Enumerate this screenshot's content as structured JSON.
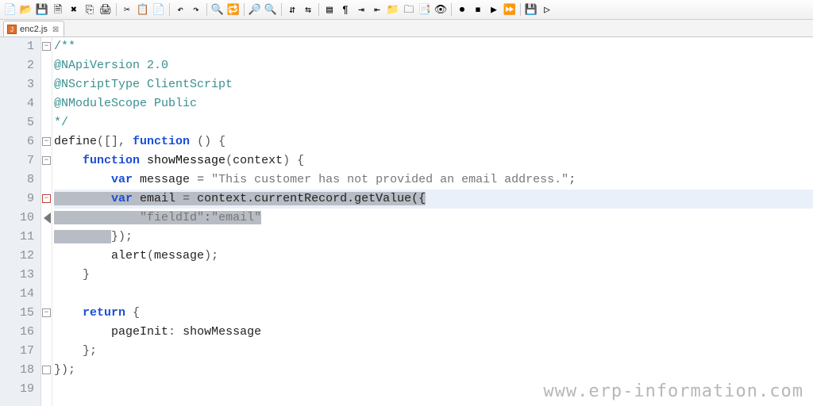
{
  "toolbar_icons": [
    {
      "name": "new-file-icon",
      "glyph": "📄"
    },
    {
      "name": "open-icon",
      "glyph": "📂"
    },
    {
      "name": "save-icon",
      "glyph": "💾"
    },
    {
      "name": "save-all-icon",
      "glyph": "🗎"
    },
    {
      "name": "close-icon",
      "glyph": "✖"
    },
    {
      "name": "close-all-icon",
      "glyph": "⎘"
    },
    {
      "name": "print-icon",
      "glyph": "🖨"
    },
    {
      "sep": true
    },
    {
      "name": "cut-icon",
      "glyph": "✂"
    },
    {
      "name": "copy-icon",
      "glyph": "📋"
    },
    {
      "name": "paste-icon",
      "glyph": "📄"
    },
    {
      "sep": true
    },
    {
      "name": "undo-icon",
      "glyph": "↶"
    },
    {
      "name": "redo-icon",
      "glyph": "↷"
    },
    {
      "sep": true
    },
    {
      "name": "find-icon",
      "glyph": "🔍"
    },
    {
      "name": "replace-icon",
      "glyph": "🔁"
    },
    {
      "sep": true
    },
    {
      "name": "zoom-in-icon",
      "glyph": "🔎"
    },
    {
      "name": "zoom-out-icon",
      "glyph": "🔍"
    },
    {
      "sep": true
    },
    {
      "name": "sync-v-icon",
      "glyph": "⇵"
    },
    {
      "name": "sync-h-icon",
      "glyph": "⇆"
    },
    {
      "sep": true
    },
    {
      "name": "wrap-icon",
      "glyph": "▤"
    },
    {
      "name": "show-all-icon",
      "glyph": "¶"
    },
    {
      "name": "indent-icon",
      "glyph": "⇥"
    },
    {
      "name": "outdent-icon",
      "glyph": "⇤"
    },
    {
      "name": "folder-icon",
      "glyph": "📁"
    },
    {
      "name": "doc-map-icon",
      "glyph": "🗀"
    },
    {
      "name": "func-list-icon",
      "glyph": "📑"
    },
    {
      "name": "monitor-icon",
      "glyph": "👁"
    },
    {
      "sep": true
    },
    {
      "name": "record-icon",
      "glyph": "⏺"
    },
    {
      "name": "stop-icon",
      "glyph": "⏹"
    },
    {
      "name": "play-icon",
      "glyph": "▶"
    },
    {
      "name": "fast-icon",
      "glyph": "⏩"
    },
    {
      "sep": true
    },
    {
      "name": "save-macro-icon",
      "glyph": "💾"
    },
    {
      "name": "run-macro-icon",
      "glyph": "▷"
    }
  ],
  "tab": {
    "filename": "enc2.js",
    "close_glyph": "⊠"
  },
  "code_lines": [
    {
      "n": 1,
      "html": "<span class='c-comment'>/**</span>"
    },
    {
      "n": 2,
      "html": "<span class='c-comment'>@NApiVersion 2.0</span>"
    },
    {
      "n": 3,
      "html": "<span class='c-comment'>@NScriptType ClientScript</span>"
    },
    {
      "n": 4,
      "html": "<span class='c-comment'>@NModuleScope Public</span>"
    },
    {
      "n": 5,
      "html": "<span class='c-comment'>*/</span>"
    },
    {
      "n": 6,
      "html": "<span class='c-plain'>define</span><span class='c-punc'>([], </span><span class='c-kw'>function</span> <span class='c-punc'>() {</span>"
    },
    {
      "n": 7,
      "html": "    <span class='c-kw'>function</span> <span class='c-fn'>showMessage</span><span class='c-punc'>(</span><span class='c-plain'>context</span><span class='c-punc'>) {</span>"
    },
    {
      "n": 8,
      "html": "        <span class='c-kw'>var</span> <span class='c-plain'>message</span> <span class='c-punc'>=</span> <span class='c-str'>\"This customer has not provided an email address.\"</span><span class='c-punc'>;</span>"
    },
    {
      "n": 9,
      "html": "<span class='sel'>        </span><span class='c-kw sel'>var</span><span class='sel'> </span><span class='c-plain sel'>email</span><span class='sel'> </span><span class='c-punc sel'>=</span><span class='sel'> </span><span class='c-plain sel'>context.currentRecord.getValue({</span>",
      "cl": "curline"
    },
    {
      "n": 10,
      "html": "<span class='sel'>            </span><span class='c-str sel'>\"fieldId\"</span><span class='c-punc sel'>:</span><span class='c-str sel'>\"email\"</span>"
    },
    {
      "n": 11,
      "html": "<span class='sel'>        </span><span class='c-punc'>});</span>"
    },
    {
      "n": 12,
      "html": "        <span class='c-plain'>alert</span><span class='c-punc'>(</span><span class='c-plain'>message</span><span class='c-punc'>);</span>"
    },
    {
      "n": 13,
      "html": "    <span class='c-punc'>}</span>"
    },
    {
      "n": 14,
      "html": ""
    },
    {
      "n": 15,
      "html": "    <span class='c-kw'>return</span> <span class='c-punc'>{</span>"
    },
    {
      "n": 16,
      "html": "        <span class='c-plain'>pageInit</span><span class='c-punc'>:</span> <span class='c-plain'>showMessage</span>"
    },
    {
      "n": 17,
      "html": "    <span class='c-punc'>};</span>"
    },
    {
      "n": 18,
      "html": "<span class='c-punc'>});</span>"
    },
    {
      "n": 19,
      "html": ""
    }
  ],
  "fold_marks": [
    {
      "line": 1,
      "glyph": "−"
    },
    {
      "line": 6,
      "glyph": "−"
    },
    {
      "line": 7,
      "glyph": "−"
    },
    {
      "line": 9,
      "glyph": "−",
      "red": true
    },
    {
      "line": 15,
      "glyph": "−"
    },
    {
      "line": 18,
      "glyph": " "
    }
  ],
  "watermark": "www.erp-information.com"
}
